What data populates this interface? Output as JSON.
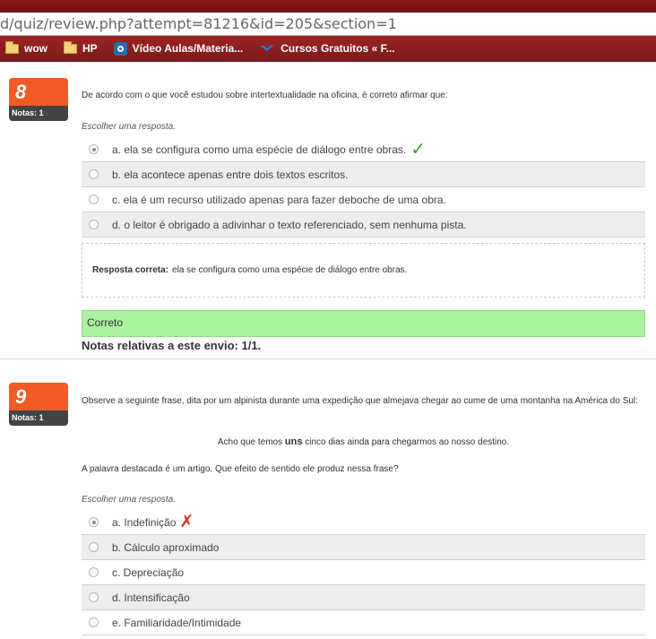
{
  "browser": {
    "url": "d/quiz/review.php?attempt=81216&id=205&section=1",
    "bookmarks": [
      {
        "label": "wow",
        "icon": "folder-icon"
      },
      {
        "label": "HP",
        "icon": "folder-icon"
      },
      {
        "label": "Vídeo Aulas/Materia...",
        "icon": "site-badge-icon"
      },
      {
        "label": "Cursos Gratuitos « F...",
        "icon": "wing-icon"
      }
    ]
  },
  "questions": [
    {
      "number": "8",
      "grade_label": "Notas: 1",
      "text": "De acordo com o que você estudou sobre intertextualidade na oficina, é correto afirmar que:",
      "prompt": "Escolher uma resposta.",
      "answers": [
        {
          "label": "a. ela se configura como uma espécie de diálogo entre obras.",
          "selected": true,
          "mark": "correct"
        },
        {
          "label": "b. ela acontece apenas entre dois textos escritos.",
          "selected": false
        },
        {
          "label": "c. ela é um recurso utilizado apenas para fazer deboche de uma obra.",
          "selected": false
        },
        {
          "label": "d. o leitor é obrigado a adivinhar o texto referenciado, sem nenhuma pista.",
          "selected": false
        }
      ],
      "feedback_label": "Resposta correta:",
      "feedback_text": "ela se configura como uma espécie de diálogo entre obras.",
      "status": "Correto",
      "grade_summary": "Notas relativas a este envio: 1/1."
    },
    {
      "number": "9",
      "grade_label": "Notas: 1",
      "text": "Observe a seguinte frase, dita por um alpinista durante uma expedição que almejava chegar ao cume de uma montanha na América do Sul:",
      "quote_before": "Acho que temos ",
      "quote_bold": "uns",
      "quote_after": " cinco dias ainda para chegarmos ao nosso destino.",
      "question": "A palavra destacada é um artigo. Que efeito de sentido ele produz nessa frase?",
      "prompt": "Escolher uma resposta.",
      "answers": [
        {
          "label": "a. Indefinição",
          "selected": true,
          "mark": "incorrect"
        },
        {
          "label": "b. Cálculo aproximado",
          "selected": false
        },
        {
          "label": "c. Depreciação",
          "selected": false
        },
        {
          "label": "d. Intensificação",
          "selected": false
        },
        {
          "label": "e. Familiaridade/Intimidade",
          "selected": false
        }
      ]
    }
  ],
  "colors": {
    "qnum_bg": "#f15a24",
    "correct_bg": "#aaf2a0",
    "check": "#3b9b2b",
    "cross": "#d9361f",
    "chrome": "#8a1b1b"
  }
}
